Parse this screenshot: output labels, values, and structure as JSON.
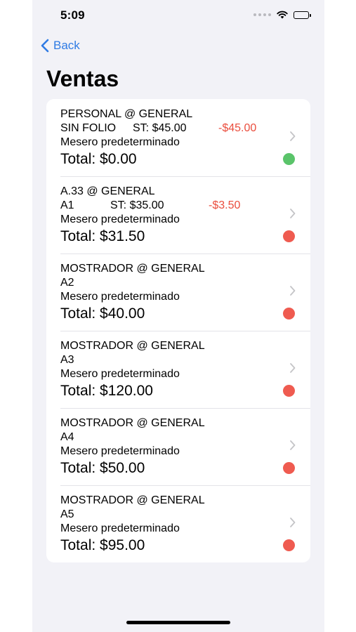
{
  "status_bar": {
    "time": "5:09"
  },
  "nav": {
    "back_label": "Back",
    "title": "Ventas"
  },
  "colors": {
    "accent": "#2f7be4",
    "paid": "#5ac46a",
    "unpaid": "#ef5b50",
    "discount": "#ea4d3d"
  },
  "sales": [
    {
      "header": "PERSONAL @ GENERAL",
      "folio": "SIN FOLIO",
      "subtotal": "ST: $45.00",
      "discount": "-$45.00",
      "waiter": "Mesero predeterminado",
      "total": "Total: $0.00",
      "status": "paid",
      "status_icon": "green-status-dot-icon"
    },
    {
      "header": "A.33 @ GENERAL",
      "folio": "A1",
      "subtotal": "ST: $35.00",
      "discount": "-$3.50",
      "waiter": "Mesero predeterminado",
      "total": "Total: $31.50",
      "status": "unpaid",
      "status_icon": "red-status-dot-icon"
    },
    {
      "header": "MOSTRADOR @ GENERAL",
      "folio": "A2",
      "waiter": "Mesero predeterminado",
      "total": "Total: $40.00",
      "status": "unpaid",
      "status_icon": "red-status-dot-icon"
    },
    {
      "header": "MOSTRADOR @ GENERAL",
      "folio": "A3",
      "waiter": "Mesero predeterminado",
      "total": "Total: $120.00",
      "status": "unpaid",
      "status_icon": "red-status-dot-icon"
    },
    {
      "header": "MOSTRADOR @ GENERAL",
      "folio": "A4",
      "waiter": "Mesero predeterminado",
      "total": "Total: $50.00",
      "status": "unpaid",
      "status_icon": "red-status-dot-icon"
    },
    {
      "header": "MOSTRADOR @ GENERAL",
      "folio": "A5",
      "waiter": "Mesero predeterminado",
      "total": "Total: $95.00",
      "status": "unpaid",
      "status_icon": "red-status-dot-icon"
    }
  ]
}
